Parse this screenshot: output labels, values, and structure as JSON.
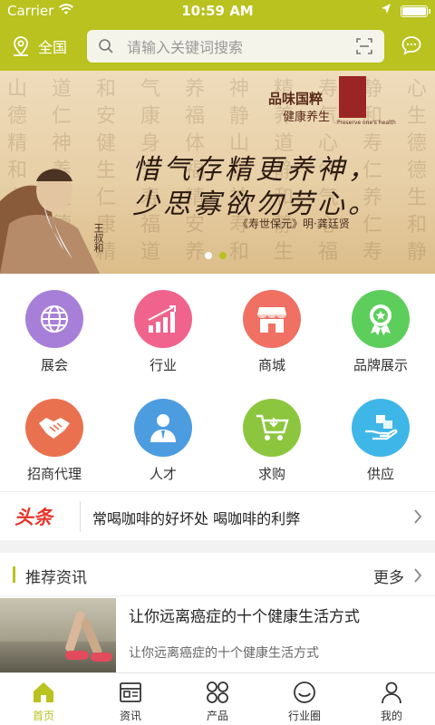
{
  "status_bar": {
    "carrier": "Carrier",
    "time": "10:59 AM"
  },
  "header": {
    "location": "全国",
    "search_placeholder": "请输入关键词搜索"
  },
  "banner": {
    "logo_text": "品味国粹",
    "logo_sub": "健康养生",
    "logo_en": "Preserve one's health",
    "line1": "惜气存精更养神，",
    "line2": "少思寡欲勿劳心。",
    "credit": "《寿世保元》明·龚廷贤",
    "signature": "王叔和",
    "slide_count": 2,
    "active_slide": 2
  },
  "categories": [
    {
      "label": "展会",
      "icon": "globe-icon",
      "color": "#a77fd9"
    },
    {
      "label": "行业",
      "icon": "growth-chart-icon",
      "color": "#f0638c"
    },
    {
      "label": "商城",
      "icon": "storefront-icon",
      "color": "#f07063"
    },
    {
      "label": "品牌展示",
      "icon": "award-badge-icon",
      "color": "#5dce5c"
    },
    {
      "label": "招商代理",
      "icon": "handshake-icon",
      "color": "#e9714f"
    },
    {
      "label": "人才",
      "icon": "person-icon",
      "color": "#4c9ce0"
    },
    {
      "label": "求购",
      "icon": "shopping-cart-icon",
      "color": "#8cc63e"
    },
    {
      "label": "供应",
      "icon": "supply-hand-icon",
      "color": "#3fb6e8"
    }
  ],
  "headline": {
    "tag": "头条",
    "text": "常喝咖啡的好坏处 喝咖啡的利弊"
  },
  "recommended": {
    "title": "推荐资讯",
    "more": "更多",
    "articles": [
      {
        "title": "让你远离癌症的十个健康生活方式",
        "summary": "让你远离癌症的十个健康生活方式"
      }
    ]
  },
  "tabbar": [
    {
      "label": "首页",
      "icon": "home-icon",
      "active": true
    },
    {
      "label": "资讯",
      "icon": "news-icon",
      "active": false
    },
    {
      "label": "产品",
      "icon": "grid-icon",
      "active": false
    },
    {
      "label": "行业圈",
      "icon": "smile-circle-icon",
      "active": false
    },
    {
      "label": "我的",
      "icon": "user-icon",
      "active": false
    }
  ],
  "colors": {
    "accent": "#b9c21e",
    "headline_red": "#e8352a"
  }
}
